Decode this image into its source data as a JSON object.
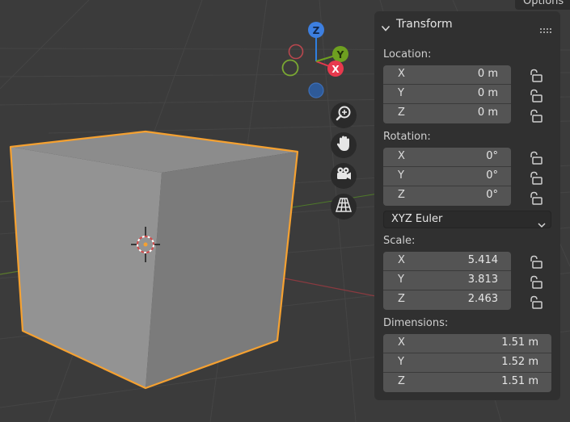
{
  "top_tab": {
    "label": "Options"
  },
  "gizmo": {
    "z": "Z",
    "y": "Y",
    "x": "X"
  },
  "panel": {
    "title": "Transform",
    "location": {
      "label": "Location:",
      "x": "0 m",
      "y": "0 m",
      "z": "0 m"
    },
    "rotation": {
      "label": "Rotation:",
      "x": "0°",
      "y": "0°",
      "z": "0°"
    },
    "rotation_mode": "XYZ Euler",
    "scale": {
      "label": "Scale:",
      "x": "5.414",
      "y": "3.813",
      "z": "2.463"
    },
    "dimensions": {
      "label": "Dimensions:",
      "x": "1.51 m",
      "y": "1.52 m",
      "z": "1.51 m"
    },
    "axes": {
      "x": "X",
      "y": "Y",
      "z": "Z"
    }
  },
  "colors": {
    "selection_outline": "#f5a131",
    "axis_x": "#e8394d",
    "axis_y": "#6ea020",
    "axis_z": "#2f7fe0"
  },
  "icons": [
    "zoom-icon",
    "hand-pan-icon",
    "camera-icon",
    "grid-perspective-icon",
    "lock-icon",
    "chevron-down-icon",
    "drag-handle-icon"
  ]
}
